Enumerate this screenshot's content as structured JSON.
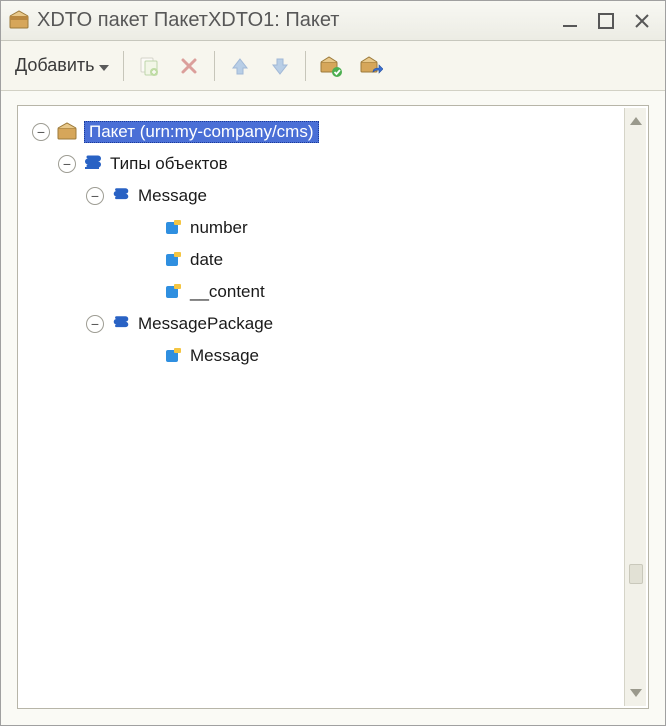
{
  "window": {
    "title": "XDTO пакет ПакетXDTO1: Пакет"
  },
  "toolbar": {
    "add_label": "Добавить"
  },
  "tree": {
    "root": {
      "label": "Пакет (urn:my-company/cms)",
      "selected": true
    },
    "types_label": "Типы объектов",
    "message": {
      "label": "Message",
      "fields": [
        "number",
        "date",
        "__content"
      ]
    },
    "message_package": {
      "label": "MessagePackage",
      "fields": [
        "Message"
      ]
    }
  }
}
